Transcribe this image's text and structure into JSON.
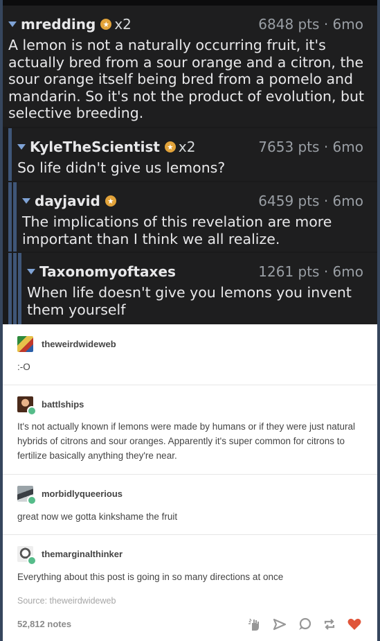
{
  "reddit_thread": [
    {
      "user": "mredding",
      "multiplier": "x2",
      "meta": "6848 pts · 6mo",
      "text": "A lemon is not a naturally occurring fruit, it's actually bred from a sour orange and a citron, the sour orange itself being bred from a pomelo and mandarin. So it's not the product of evolution, but selective breeding."
    },
    {
      "user": "KyleTheScientist",
      "multiplier": "x2",
      "meta": "7653 pts · 6mo",
      "text": "So life didn't give us lemons?"
    },
    {
      "user": "dayjavid",
      "multiplier": "",
      "meta": "6459 pts · 6mo",
      "text": "The implications of this revelation are more important than I think we all realize."
    },
    {
      "user": "Taxonomyoftaxes",
      "multiplier": "",
      "meta": "1261 pts · 6mo",
      "text": "When life doesn't give you lemons you invent them yourself"
    }
  ],
  "reblogs": [
    {
      "user": "theweirdwideweb",
      "text": ":-O"
    },
    {
      "user": "battlships",
      "text": "It's not actually known if lemons were made by humans or if they were just natural hybrids of citrons and sour oranges. Apparently it's super common for citrons to fertilize basically anything they're near."
    },
    {
      "user": "morbidlyqueerious",
      "text": "great now we gotta kinkshame the fruit"
    },
    {
      "user": "themarginalthinker",
      "text": "Everything about this post is going in so many directions at once"
    }
  ],
  "footer": {
    "source": "Source: theweirdwideweb",
    "notes": "52,812 notes"
  },
  "actions": [
    "hand-clap-icon",
    "share-icon",
    "reply-icon",
    "reblog-icon",
    "heart-icon"
  ],
  "colors": {
    "like": "#e0553a",
    "actions": "#979797",
    "background": "#36465d"
  }
}
